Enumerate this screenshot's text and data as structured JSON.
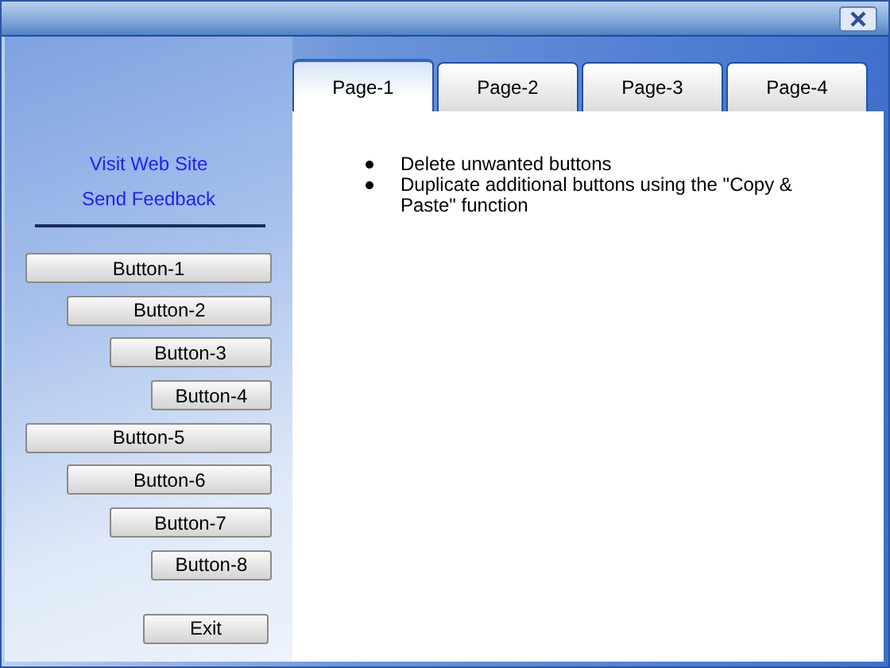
{
  "links": [
    "Visit Web Site",
    "Send Feedback"
  ],
  "tabs": [
    {
      "label": "Page-1",
      "selected": true
    },
    {
      "label": "Page-2",
      "selected": false
    },
    {
      "label": "Page-3",
      "selected": false
    },
    {
      "label": "Page-4",
      "selected": false
    }
  ],
  "bullets": [
    "Delete unwanted buttons",
    "Duplicate additional buttons using the \"Copy & Paste\" function"
  ],
  "buttons": [
    "Button-1",
    "Button-2",
    "Button-3",
    "Button-4",
    "Button-5",
    "Button-6",
    "Button-7",
    "Button-8"
  ],
  "exit_button": "Exit"
}
